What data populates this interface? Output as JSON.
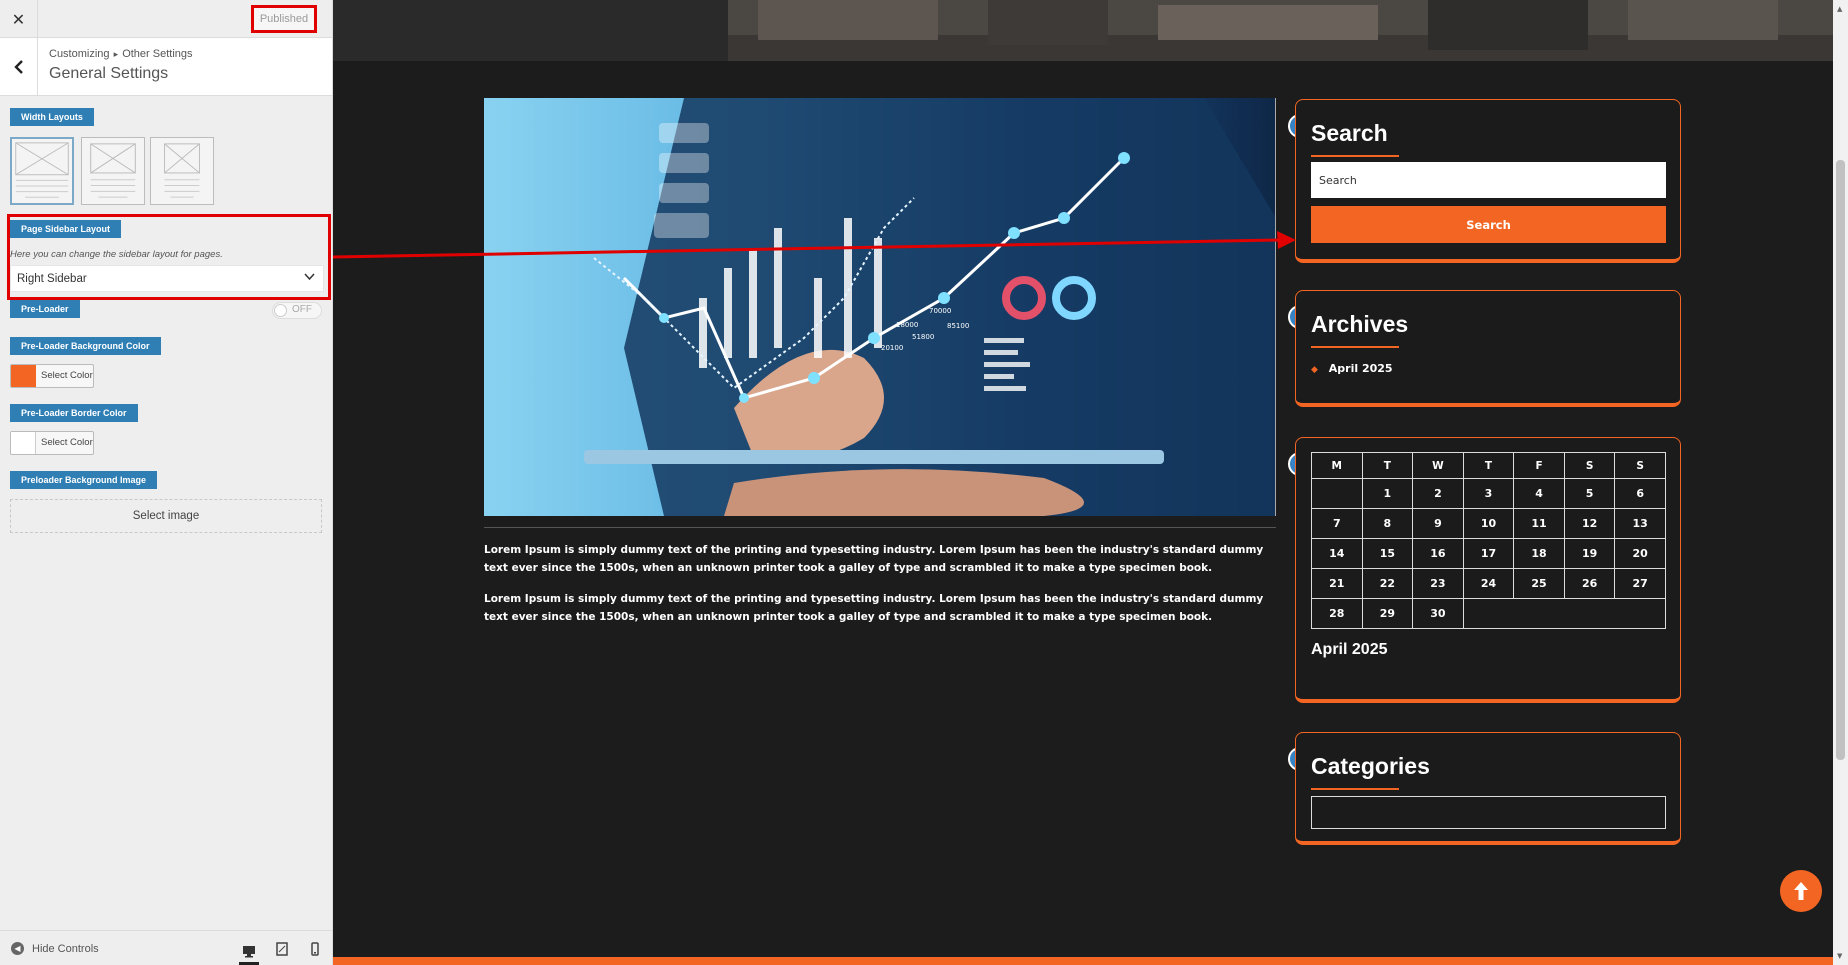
{
  "customizer": {
    "close_label": "✕",
    "publish_label": "Published",
    "breadcrumb_root": "Customizing",
    "breadcrumb_sep": "▸",
    "breadcrumb_parent": "Other Settings",
    "section_title": "General Settings",
    "width_layouts_label": "Width Layouts",
    "page_sidebar_label": "Page Sidebar Layout",
    "page_sidebar_desc": "Here you can change the sidebar layout for pages.",
    "page_sidebar_value": "Right Sidebar",
    "preloader_label": "Pre-Loader",
    "preloader_toggle": "OFF",
    "preloader_bg_label": "Pre-Loader Background Color",
    "preloader_bg_btn": "Select Color",
    "preloader_bg_color": "#f26522",
    "preloader_border_label": "Pre-Loader Border Color",
    "preloader_border_btn": "Select Color",
    "preloader_border_color": "#ffffff",
    "preloader_image_label": "Preloader Background Image",
    "select_image_label": "Select image",
    "hide_controls_label": "Hide Controls"
  },
  "post": {
    "paragraphs": [
      "Lorem Ipsum is simply dummy text of the printing and typesetting industry. Lorem Ipsum has been the industry's standard dummy text ever since the 1500s, when an unknown printer took a galley of type and scrambled it to make a type specimen book.",
      "Lorem Ipsum is simply dummy text of the printing and typesetting industry. Lorem Ipsum has been the industry's standard dummy text ever since the 1500s, when an unknown printer took a galley of type and scrambled it to make a type specimen book."
    ],
    "image_figures": [
      "70000",
      "85100",
      "51800",
      "20100",
      "18000"
    ]
  },
  "sidebar": {
    "search_title": "Search",
    "search_placeholder": "Search",
    "search_button": "Search",
    "archives_title": "Archives",
    "archive_item": "April 2025",
    "calendar_days": [
      "M",
      "T",
      "W",
      "T",
      "F",
      "S",
      "S"
    ],
    "calendar_rows": [
      [
        "",
        "1",
        "2",
        "3",
        "4",
        "5",
        "6"
      ],
      [
        "7",
        "8",
        "9",
        "10",
        "11",
        "12",
        "13"
      ],
      [
        "14",
        "15",
        "16",
        "17",
        "18",
        "19",
        "20"
      ],
      [
        "21",
        "22",
        "23",
        "24",
        "25",
        "26",
        "27"
      ],
      [
        "28",
        "29",
        "30",
        "",
        "",
        "",
        ""
      ]
    ],
    "calendar_caption": "April 2025",
    "categories_title": "Categories"
  },
  "colors": {
    "accent": "#f26522",
    "label_blue": "#2f7fb5",
    "annotation_red": "#e00000",
    "page_bg": "#1c1c1c"
  },
  "icons": [
    "close-icon",
    "back-chevron-icon",
    "chevron-down-icon",
    "hide-controls-icon",
    "desktop-icon",
    "tablet-icon",
    "mobile-icon",
    "pencil-icon",
    "arrow-up-icon"
  ]
}
